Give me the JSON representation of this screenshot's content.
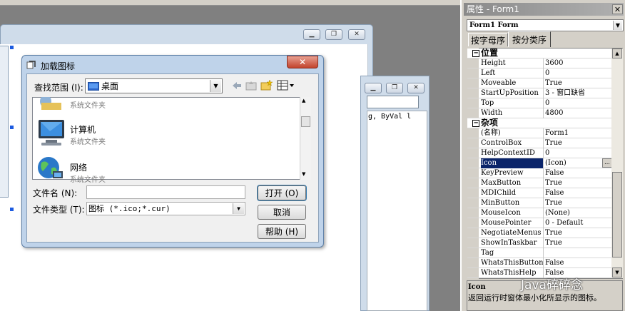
{
  "dialog": {
    "title": "加载图标",
    "close_glyph": "✕",
    "lookin_label": "查找范围 (I):",
    "lookin_value": "桌面",
    "files": [
      {
        "name": "",
        "type": "系统文件夹"
      },
      {
        "name": "计算机",
        "type": "系统文件夹"
      },
      {
        "name": "网络",
        "type": "系统文件夹"
      }
    ],
    "filename_label": "文件名 (N):",
    "filename_value": "",
    "filetype_label": "文件类型 (T):",
    "filetype_value": "图标  (*.ico;*.cur)",
    "open_label": "打开 (O)",
    "cancel_label": "取消",
    "help_label": "帮助 (H)"
  },
  "code_window": {
    "snippet": "g, ByVal l"
  },
  "properties": {
    "title": "属性 - Form1",
    "close_glyph": "✕",
    "object": "Form1 Form",
    "tabs": [
      "按字母序",
      "按分类序"
    ],
    "active_tab": 1,
    "rows": [
      {
        "kind": "cat",
        "name": "位置"
      },
      {
        "name": "Height",
        "value": "3600"
      },
      {
        "name": "Left",
        "value": "0"
      },
      {
        "name": "Moveable",
        "value": "True"
      },
      {
        "name": "StartUpPosition",
        "value": "3 - 窗口缺省"
      },
      {
        "name": "Top",
        "value": "0"
      },
      {
        "name": "Width",
        "value": "4800"
      },
      {
        "kind": "cat",
        "name": "杂项"
      },
      {
        "name": "(名称)",
        "value": "Form1"
      },
      {
        "name": "ControlBox",
        "value": "True"
      },
      {
        "name": "HelpContextID",
        "value": "0"
      },
      {
        "name": "Icon",
        "value": "(Icon)",
        "selected": true
      },
      {
        "name": "KeyPreview",
        "value": "False"
      },
      {
        "name": "MaxButton",
        "value": "True"
      },
      {
        "name": "MDIChild",
        "value": "False"
      },
      {
        "name": "MinButton",
        "value": "True"
      },
      {
        "name": "MouseIcon",
        "value": "(None)"
      },
      {
        "name": "MousePointer",
        "value": "0 - Default"
      },
      {
        "name": "NegotiateMenus",
        "value": "True"
      },
      {
        "name": "ShowInTaskbar",
        "value": "True"
      },
      {
        "name": "Tag",
        "value": ""
      },
      {
        "name": "WhatsThisButton",
        "value": "False"
      },
      {
        "name": "WhatsThisHelp",
        "value": "False"
      }
    ],
    "desc_title": "Icon",
    "desc_text": "返回运行时窗体最小化所显示的图标。"
  },
  "watermark": "Java碎碎念",
  "colors": {
    "selection": "#0a246a",
    "desktop_bg": "#808080",
    "dialog_frame": "#bfd3ea"
  }
}
